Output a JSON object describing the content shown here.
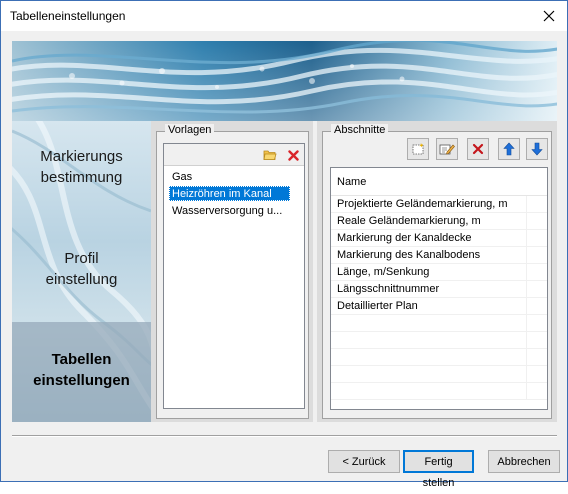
{
  "window": {
    "title": "Tabelleneinstellungen"
  },
  "nav": {
    "items": [
      {
        "line1": "Markierungs",
        "line2": "bestimmung"
      },
      {
        "line1": "Profil",
        "line2": "einstellung"
      },
      {
        "line1": "Tabellen",
        "line2": "einstellungen"
      }
    ],
    "active_index": 2
  },
  "templates": {
    "group_title": "Vorlagen",
    "items": [
      "Gas",
      "Heizröhren im Kanal",
      "Wasserversorgung u..."
    ],
    "selected_index": 1,
    "toolbar_icons": [
      "open-folder-icon",
      "delete-icon"
    ]
  },
  "sections": {
    "group_title": "Abschnitte",
    "toolbar_icons": [
      "new-section-icon",
      "edit-icon",
      "delete-icon",
      "arrow-up-icon",
      "arrow-down-icon"
    ],
    "column_header": "Name",
    "rows": [
      "Projektierte Geländemarkierung, m",
      "Reale Geländemarkierung, m",
      "Markierung der Kanaldecke",
      "Markierung des Kanalbodens",
      "Länge, m/Senkung",
      "Längsschnittnummer",
      "Detaillierter Plan"
    ]
  },
  "buttons": {
    "back": "< Zurück",
    "finish": "Fertig stellen",
    "cancel": "Abbrechen"
  },
  "colors": {
    "selection": "#0078d7",
    "window_border": "#3c6fb5",
    "delete_red": "#d9252a",
    "arrow_blue": "#1e6fd9"
  }
}
